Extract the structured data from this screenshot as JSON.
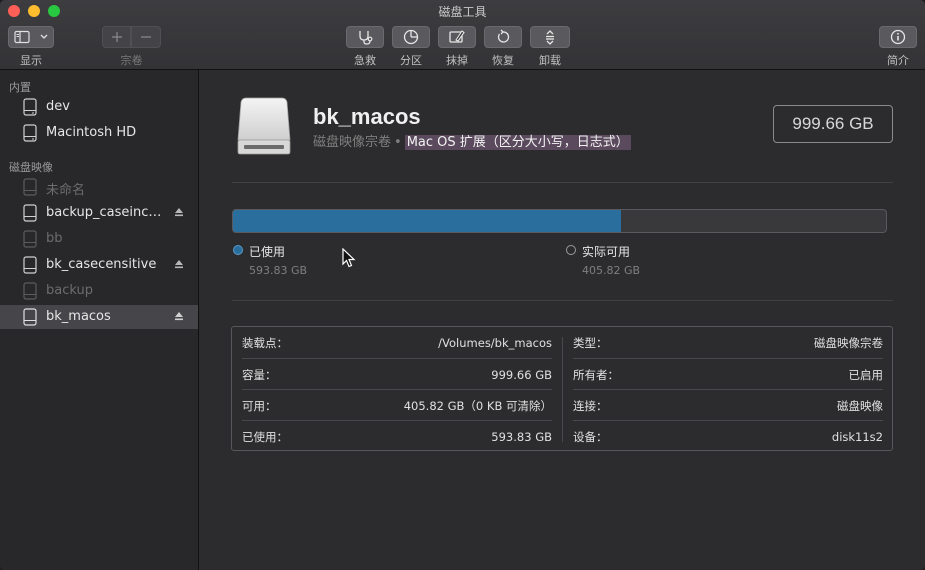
{
  "window": {
    "title": "磁盘工具"
  },
  "toolbar": {
    "view_label": "显示",
    "volume_label": "宗卷",
    "first_aid_label": "急救",
    "partition_label": "分区",
    "erase_label": "抹掉",
    "restore_label": "恢复",
    "unmount_label": "卸载",
    "info_label": "简介"
  },
  "sidebar": {
    "internal_heading": "内置",
    "internal_items": [
      {
        "label": "dev",
        "icon": "internal-disk-icon"
      },
      {
        "label": "Macintosh HD",
        "icon": "internal-disk-icon"
      }
    ],
    "images_heading": "磁盘映像",
    "image_items": [
      {
        "label": "未命名",
        "dim": true,
        "eject": false
      },
      {
        "label": "backup_caseincensitive",
        "dim": false,
        "eject": true
      },
      {
        "label": "bb",
        "dim": true,
        "eject": false
      },
      {
        "label": "bk_casecensitive",
        "dim": false,
        "eject": true
      },
      {
        "label": "backup",
        "dim": true,
        "eject": false
      },
      {
        "label": "bk_macos",
        "dim": false,
        "eject": true,
        "selected": true
      }
    ]
  },
  "volume": {
    "name": "bk_macos",
    "kind": "磁盘映像宗卷",
    "separator": "•",
    "format": "Mac OS 扩展（区分大小写，日志式）",
    "capacity": "999.66 GB"
  },
  "usage": {
    "used_fraction": 0.594,
    "used_label": "已使用",
    "used_value": "593.83 GB",
    "used_color": "#2a6e9e",
    "free_label": "实际可用",
    "free_value": "405.82 GB"
  },
  "info": {
    "left": [
      {
        "key": "装载点：",
        "value": "/Volumes/bk_macos"
      },
      {
        "key": "容量：",
        "value": "999.66 GB"
      },
      {
        "key": "可用：",
        "value": "405.82 GB（0 KB 可清除）"
      },
      {
        "key": "已使用：",
        "value": "593.83 GB"
      }
    ],
    "right": [
      {
        "key": "类型：",
        "value": "磁盘映像宗卷"
      },
      {
        "key": "所有者：",
        "value": "已启用"
      },
      {
        "key": "连接：",
        "value": "磁盘映像"
      },
      {
        "key": "设备：",
        "value": "disk11s2"
      }
    ]
  }
}
